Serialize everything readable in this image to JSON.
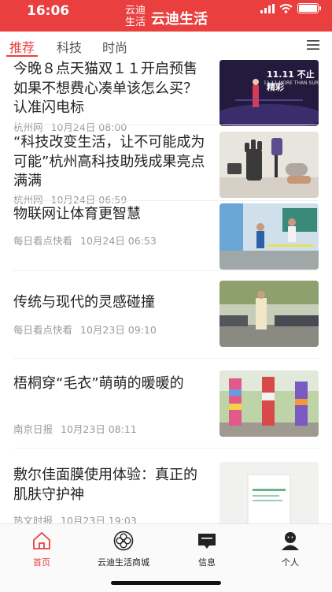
{
  "status": {
    "time": "16:06"
  },
  "app": {
    "logo_line1": "云迪",
    "logo_line2": "生活",
    "title": "云迪生活"
  },
  "tabs": [
    {
      "label": "推荐",
      "active": true
    },
    {
      "label": "科技",
      "active": false
    },
    {
      "label": "时尚",
      "active": false
    }
  ],
  "feed": [
    {
      "title": "今晚８点天猫双１１开启预售如果不想费心凑单该怎么买？认准闪电标",
      "source": "杭州网",
      "date": "10月24日 08:00",
      "thumb_caption": "11.11 不止精彩",
      "thumb_subcaption": "11.11 MORE THAN SUR",
      "thumb_icon": "stage-photo-icon"
    },
    {
      "title": "“科技改变生活，让不可能成为可能”杭州高科技助残成果亮点满满",
      "source": "杭州网",
      "date": "10月24日 06:59",
      "thumb_icon": "robotic-hand-photo-icon"
    },
    {
      "title": "物联网让体育更智慧",
      "source": "每日看点快看",
      "date": "10月24日 06:53",
      "thumb_icon": "sports-photo-icon"
    },
    {
      "title": "传统与现代的灵感碰撞",
      "source": "每日看点快看",
      "date": "10月23日 09:10",
      "thumb_icon": "fashion-show-photo-icon"
    },
    {
      "title": "梧桐穿“毛衣”萌萌的暖暖的",
      "source": "南京日报",
      "date": "10月23日 08:11",
      "thumb_icon": "knitted-trees-photo-icon"
    },
    {
      "title": "敷尔佳面膜使用体验：真正的肌肤守护神",
      "source": "热文时报",
      "date": "10月23日 19:03",
      "thumb_icon": "product-box-photo-icon"
    }
  ],
  "tabbar": [
    {
      "label": "首页",
      "icon": "home-icon",
      "active": true
    },
    {
      "label": "云迪生活商城",
      "icon": "shop-flower-icon",
      "active": false
    },
    {
      "label": "信息",
      "icon": "message-icon",
      "active": false
    },
    {
      "label": "个人",
      "icon": "person-icon",
      "active": false
    }
  ],
  "colors": {
    "accent": "#e9403f",
    "meta": "#9a9a9a",
    "text": "#222222"
  }
}
